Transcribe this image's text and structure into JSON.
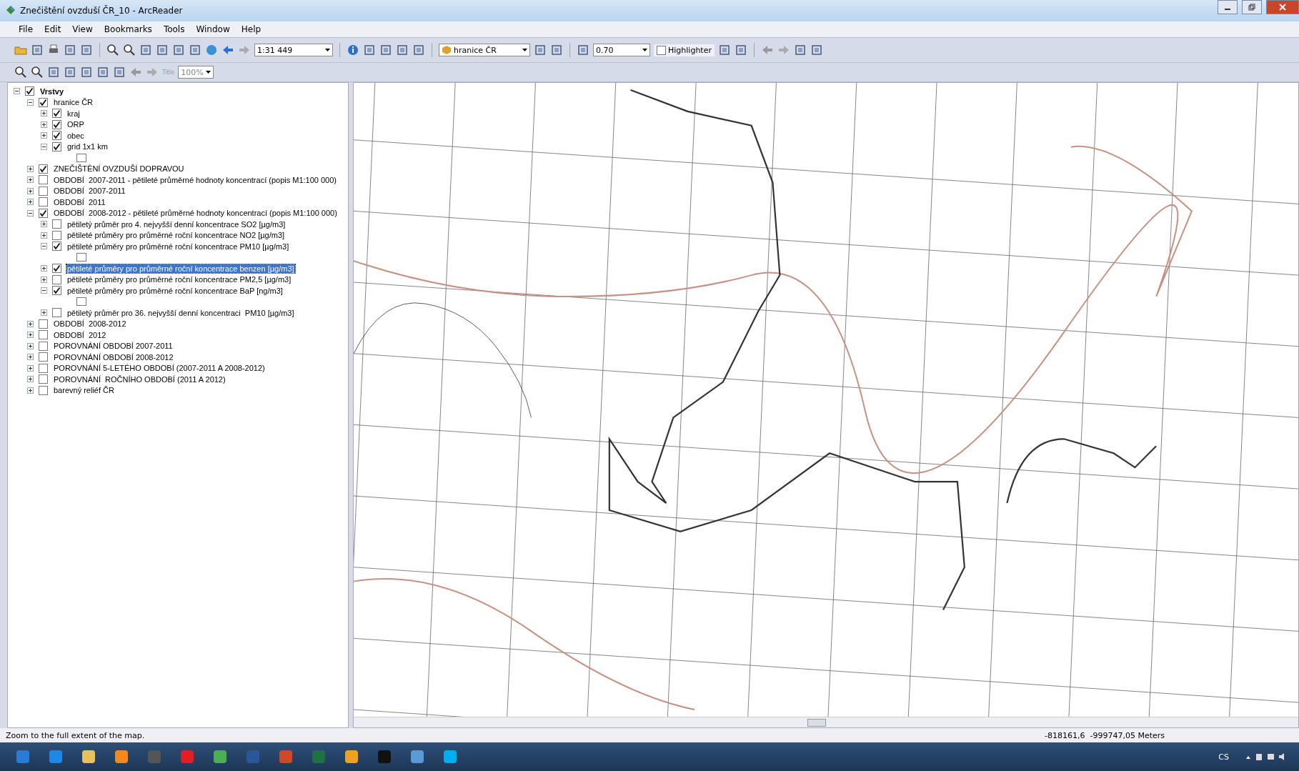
{
  "window": {
    "title": "Znečištění ovzduší ČR_10 - ArcReader"
  },
  "menu": [
    "File",
    "Edit",
    "View",
    "Bookmarks",
    "Tools",
    "Window",
    "Help"
  ],
  "toolbar": {
    "scale": "1:31 449",
    "layer": "hranice ČR",
    "transparency": "0.70",
    "highlighter": {
      "label": "Highlighter",
      "checked": false
    },
    "title_button": "Title",
    "zoom": "100%"
  },
  "toc": {
    "label": "Vrstvy",
    "checked": true,
    "expanded": true,
    "selected": false,
    "children": [
      {
        "label": "hranice ČR",
        "checked": true,
        "expanded": true,
        "selected": false,
        "children": [
          {
            "label": "kraj",
            "checked": true,
            "expanded": false,
            "selected": false
          },
          {
            "label": "ORP",
            "checked": true,
            "expanded": false,
            "selected": false
          },
          {
            "label": "obec",
            "checked": true,
            "expanded": false,
            "selected": false
          },
          {
            "label": "grid 1x1 km",
            "checked": true,
            "expanded": true,
            "selected": false
          }
        ]
      },
      {
        "label": "ZNEČIŠTĚNÍ OVZDUŠÍ DOPRAVOU",
        "checked": true,
        "expanded": false,
        "selected": false
      },
      {
        "label": "OBDOBÍ  2007-2011 - pětileté průměrné hodnoty koncentrací (popis M1:100 000)",
        "checked": false,
        "expanded": false,
        "selected": false
      },
      {
        "label": "OBDOBÍ  2007-2011",
        "checked": false,
        "expanded": false,
        "selected": false
      },
      {
        "label": "OBDOBÍ  2011",
        "checked": false,
        "expanded": false,
        "selected": false
      },
      {
        "label": "OBDOBÍ  2008-2012 - pětileté průměrné hodnoty koncentrací (popis M1:100 000)",
        "checked": true,
        "expanded": true,
        "selected": false,
        "children": [
          {
            "label": "pětiletý průměr pro 4. nejvyšší denní koncentrace SO2 [µg/m3]",
            "checked": false,
            "expanded": false,
            "selected": false
          },
          {
            "label": "pětileté průměry pro průměrné roční koncentrace NO2 [µg/m3]",
            "checked": false,
            "expanded": false,
            "selected": false
          },
          {
            "label": "pětileté průměry pro průměrné roční koncentrace PM10 [µg/m3]",
            "checked": true,
            "expanded": true,
            "selected": false
          },
          {
            "label": "pětileté průměry pro průměrné roční koncentrace benzen [µg/m3]",
            "checked": true,
            "expanded": false,
            "selected": true
          },
          {
            "label": "pětileté průměry pro průměrné roční koncentrace PM2,5 [µg/m3]",
            "checked": false,
            "expanded": false,
            "selected": false
          },
          {
            "label": "pětileté průměry pro průměrné roční koncentrace BaP [ng/m3]",
            "checked": true,
            "expanded": true,
            "selected": false
          },
          {
            "label": "pětiletý průměr pro 36. nejvyšší denní koncentraci  PM10 [µg/m3]",
            "checked": false,
            "expanded": false,
            "selected": false
          }
        ]
      },
      {
        "label": "OBDOBÍ  2008-2012",
        "checked": false,
        "expanded": false,
        "selected": false
      },
      {
        "label": "OBDOBÍ  2012",
        "checked": false,
        "expanded": false,
        "selected": false
      },
      {
        "label": "POROVNÁNÍ OBDOBÍ 2007-2011",
        "checked": false,
        "expanded": false,
        "selected": false
      },
      {
        "label": "POROVNÁNÍ OBDOBÍ 2008-2012",
        "checked": false,
        "expanded": false,
        "selected": false
      },
      {
        "label": "POROVNÁNÍ 5-LETÉHO OBDOBÍ (2007-2011 A 2008-2012)",
        "checked": false,
        "expanded": false,
        "selected": false
      },
      {
        "label": "POROVNÁNÍ  ROČNÍHO OBDOBÍ (2011 A 2012)",
        "checked": false,
        "expanded": false,
        "selected": false
      },
      {
        "label": "barevný reliéf ČR",
        "checked": false,
        "expanded": false,
        "selected": false
      }
    ]
  },
  "status_bar": {
    "message": "Zoom to the full extent of the map.",
    "coordinates": "-818161,6  -999747,05 Meters"
  },
  "taskbar": {
    "language": "CS"
  }
}
